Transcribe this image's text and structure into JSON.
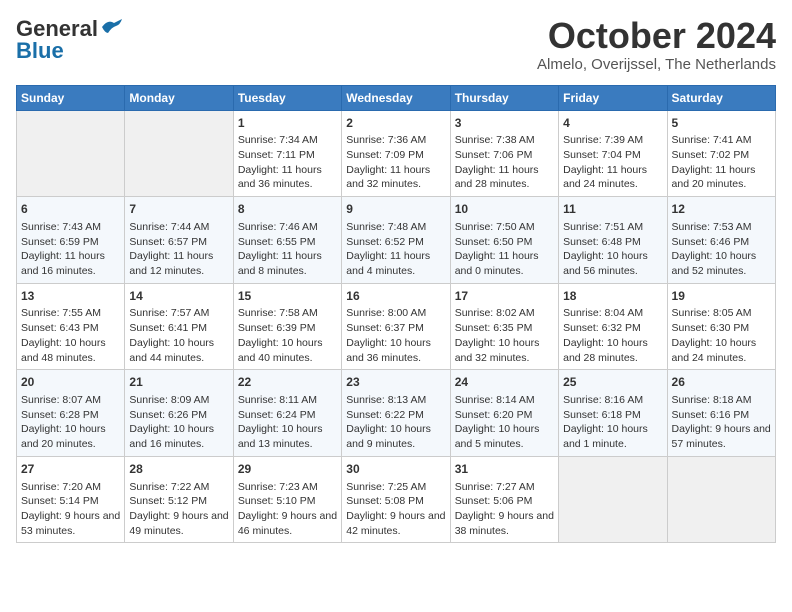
{
  "header": {
    "logo_general": "General",
    "logo_blue": "Blue",
    "title": "October 2024",
    "subtitle": "Almelo, Overijssel, The Netherlands"
  },
  "days_of_week": [
    "Sunday",
    "Monday",
    "Tuesday",
    "Wednesday",
    "Thursday",
    "Friday",
    "Saturday"
  ],
  "weeks": [
    [
      {
        "day": "",
        "empty": true
      },
      {
        "day": "",
        "empty": true
      },
      {
        "day": "1",
        "sunrise": "Sunrise: 7:34 AM",
        "sunset": "Sunset: 7:11 PM",
        "daylight": "Daylight: 11 hours and 36 minutes."
      },
      {
        "day": "2",
        "sunrise": "Sunrise: 7:36 AM",
        "sunset": "Sunset: 7:09 PM",
        "daylight": "Daylight: 11 hours and 32 minutes."
      },
      {
        "day": "3",
        "sunrise": "Sunrise: 7:38 AM",
        "sunset": "Sunset: 7:06 PM",
        "daylight": "Daylight: 11 hours and 28 minutes."
      },
      {
        "day": "4",
        "sunrise": "Sunrise: 7:39 AM",
        "sunset": "Sunset: 7:04 PM",
        "daylight": "Daylight: 11 hours and 24 minutes."
      },
      {
        "day": "5",
        "sunrise": "Sunrise: 7:41 AM",
        "sunset": "Sunset: 7:02 PM",
        "daylight": "Daylight: 11 hours and 20 minutes."
      }
    ],
    [
      {
        "day": "6",
        "sunrise": "Sunrise: 7:43 AM",
        "sunset": "Sunset: 6:59 PM",
        "daylight": "Daylight: 11 hours and 16 minutes."
      },
      {
        "day": "7",
        "sunrise": "Sunrise: 7:44 AM",
        "sunset": "Sunset: 6:57 PM",
        "daylight": "Daylight: 11 hours and 12 minutes."
      },
      {
        "day": "8",
        "sunrise": "Sunrise: 7:46 AM",
        "sunset": "Sunset: 6:55 PM",
        "daylight": "Daylight: 11 hours and 8 minutes."
      },
      {
        "day": "9",
        "sunrise": "Sunrise: 7:48 AM",
        "sunset": "Sunset: 6:52 PM",
        "daylight": "Daylight: 11 hours and 4 minutes."
      },
      {
        "day": "10",
        "sunrise": "Sunrise: 7:50 AM",
        "sunset": "Sunset: 6:50 PM",
        "daylight": "Daylight: 11 hours and 0 minutes."
      },
      {
        "day": "11",
        "sunrise": "Sunrise: 7:51 AM",
        "sunset": "Sunset: 6:48 PM",
        "daylight": "Daylight: 10 hours and 56 minutes."
      },
      {
        "day": "12",
        "sunrise": "Sunrise: 7:53 AM",
        "sunset": "Sunset: 6:46 PM",
        "daylight": "Daylight: 10 hours and 52 minutes."
      }
    ],
    [
      {
        "day": "13",
        "sunrise": "Sunrise: 7:55 AM",
        "sunset": "Sunset: 6:43 PM",
        "daylight": "Daylight: 10 hours and 48 minutes."
      },
      {
        "day": "14",
        "sunrise": "Sunrise: 7:57 AM",
        "sunset": "Sunset: 6:41 PM",
        "daylight": "Daylight: 10 hours and 44 minutes."
      },
      {
        "day": "15",
        "sunrise": "Sunrise: 7:58 AM",
        "sunset": "Sunset: 6:39 PM",
        "daylight": "Daylight: 10 hours and 40 minutes."
      },
      {
        "day": "16",
        "sunrise": "Sunrise: 8:00 AM",
        "sunset": "Sunset: 6:37 PM",
        "daylight": "Daylight: 10 hours and 36 minutes."
      },
      {
        "day": "17",
        "sunrise": "Sunrise: 8:02 AM",
        "sunset": "Sunset: 6:35 PM",
        "daylight": "Daylight: 10 hours and 32 minutes."
      },
      {
        "day": "18",
        "sunrise": "Sunrise: 8:04 AM",
        "sunset": "Sunset: 6:32 PM",
        "daylight": "Daylight: 10 hours and 28 minutes."
      },
      {
        "day": "19",
        "sunrise": "Sunrise: 8:05 AM",
        "sunset": "Sunset: 6:30 PM",
        "daylight": "Daylight: 10 hours and 24 minutes."
      }
    ],
    [
      {
        "day": "20",
        "sunrise": "Sunrise: 8:07 AM",
        "sunset": "Sunset: 6:28 PM",
        "daylight": "Daylight: 10 hours and 20 minutes."
      },
      {
        "day": "21",
        "sunrise": "Sunrise: 8:09 AM",
        "sunset": "Sunset: 6:26 PM",
        "daylight": "Daylight: 10 hours and 16 minutes."
      },
      {
        "day": "22",
        "sunrise": "Sunrise: 8:11 AM",
        "sunset": "Sunset: 6:24 PM",
        "daylight": "Daylight: 10 hours and 13 minutes."
      },
      {
        "day": "23",
        "sunrise": "Sunrise: 8:13 AM",
        "sunset": "Sunset: 6:22 PM",
        "daylight": "Daylight: 10 hours and 9 minutes."
      },
      {
        "day": "24",
        "sunrise": "Sunrise: 8:14 AM",
        "sunset": "Sunset: 6:20 PM",
        "daylight": "Daylight: 10 hours and 5 minutes."
      },
      {
        "day": "25",
        "sunrise": "Sunrise: 8:16 AM",
        "sunset": "Sunset: 6:18 PM",
        "daylight": "Daylight: 10 hours and 1 minute."
      },
      {
        "day": "26",
        "sunrise": "Sunrise: 8:18 AM",
        "sunset": "Sunset: 6:16 PM",
        "daylight": "Daylight: 9 hours and 57 minutes."
      }
    ],
    [
      {
        "day": "27",
        "sunrise": "Sunrise: 7:20 AM",
        "sunset": "Sunset: 5:14 PM",
        "daylight": "Daylight: 9 hours and 53 minutes."
      },
      {
        "day": "28",
        "sunrise": "Sunrise: 7:22 AM",
        "sunset": "Sunset: 5:12 PM",
        "daylight": "Daylight: 9 hours and 49 minutes."
      },
      {
        "day": "29",
        "sunrise": "Sunrise: 7:23 AM",
        "sunset": "Sunset: 5:10 PM",
        "daylight": "Daylight: 9 hours and 46 minutes."
      },
      {
        "day": "30",
        "sunrise": "Sunrise: 7:25 AM",
        "sunset": "Sunset: 5:08 PM",
        "daylight": "Daylight: 9 hours and 42 minutes."
      },
      {
        "day": "31",
        "sunrise": "Sunrise: 7:27 AM",
        "sunset": "Sunset: 5:06 PM",
        "daylight": "Daylight: 9 hours and 38 minutes."
      },
      {
        "day": "",
        "empty": true
      },
      {
        "day": "",
        "empty": true
      }
    ]
  ]
}
